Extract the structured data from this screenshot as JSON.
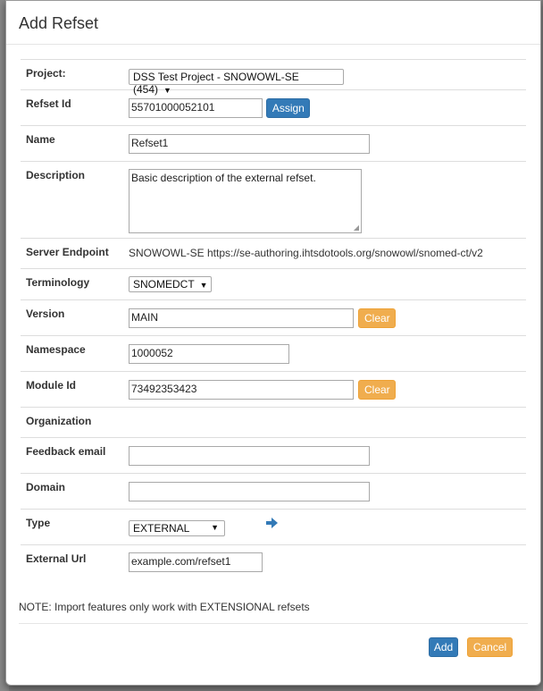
{
  "dialog": {
    "title": "Add Refset"
  },
  "fields": {
    "project": {
      "label": "Project:",
      "value": "DSS Test Project - SNOWOWL-SE (454)"
    },
    "refset_id": {
      "label": "Refset Id",
      "value": "55701000052101",
      "assign_label": "Assign"
    },
    "name": {
      "label": "Name",
      "value": "Refset1"
    },
    "description": {
      "label": "Description",
      "value": "Basic description of the external refset."
    },
    "server_endpoint": {
      "label": "Server Endpoint",
      "value": "SNOWOWL-SE https://se-authoring.ihtsdotools.org/snowowl/snomed-ct/v2"
    },
    "terminology": {
      "label": "Terminology",
      "value": "SNOMEDCT"
    },
    "version": {
      "label": "Version",
      "value": "MAIN",
      "clear_label": "Clear"
    },
    "namespace": {
      "label": "Namespace",
      "value": "1000052"
    },
    "module_id": {
      "label": "Module Id",
      "value": "73492353423",
      "clear_label": "Clear"
    },
    "organization": {
      "label": "Organization"
    },
    "feedback_email": {
      "label": "Feedback email",
      "value": ""
    },
    "domain": {
      "label": "Domain",
      "value": ""
    },
    "type": {
      "label": "Type",
      "value": "EXTERNAL"
    },
    "external_url": {
      "label": "External Url",
      "value": "example.com/refset1"
    }
  },
  "note": "NOTE: Import features only work with EXTENSIONAL refsets",
  "footer": {
    "add_label": "Add",
    "cancel_label": "Cancel"
  },
  "colors": {
    "primary": "#337ab7",
    "warning": "#f0ad4e",
    "backdrop": "#7f7f7f"
  },
  "icons": {
    "type_action": "arrow-right-icon",
    "dropdown": "caret-down-icon"
  }
}
